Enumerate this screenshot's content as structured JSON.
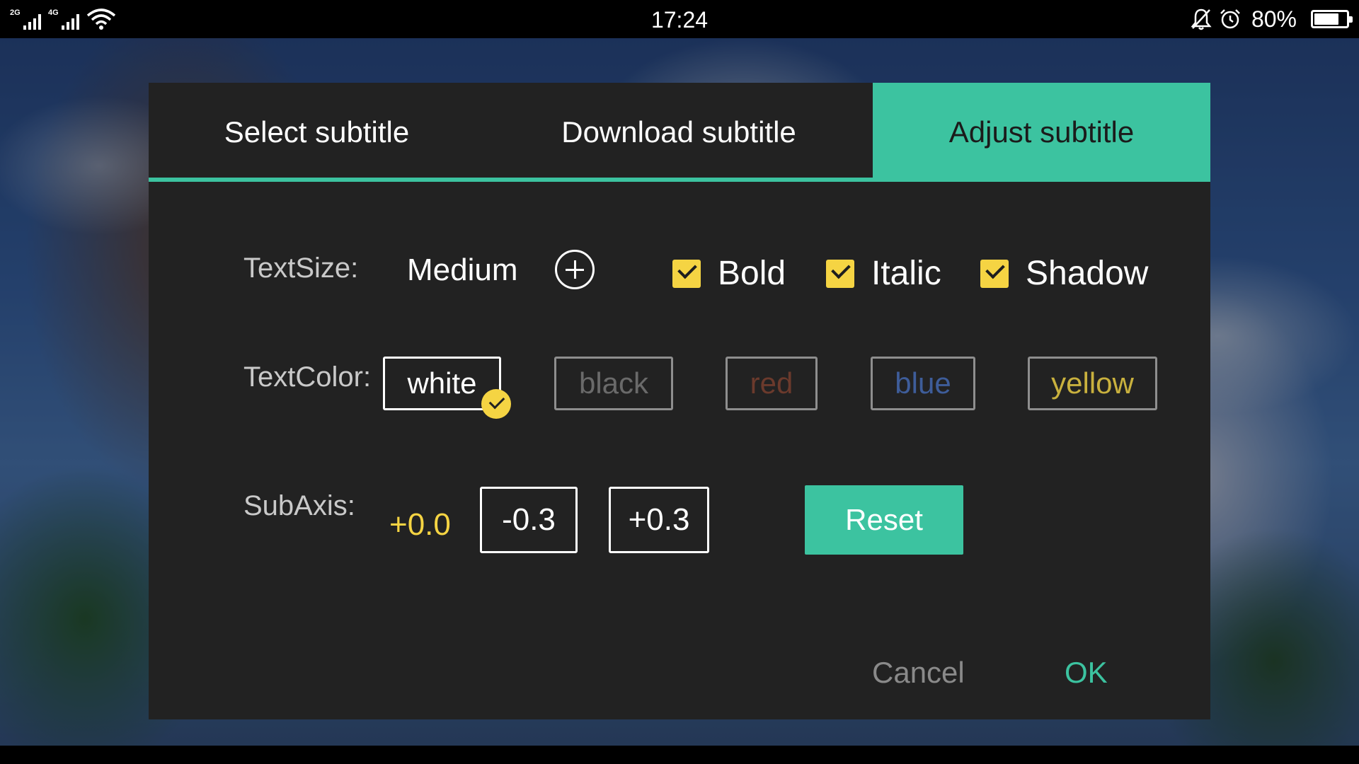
{
  "status_bar": {
    "network_1": "2G",
    "network_2": "4G",
    "time": "17:24",
    "battery_percent": "80%",
    "battery_level": 0.8,
    "icons": [
      "signal-icon",
      "signal-icon",
      "wifi-icon",
      "bell-muted-icon",
      "alarm-icon",
      "battery-icon"
    ]
  },
  "dialog": {
    "tabs": [
      {
        "label": "Select subtitle",
        "active": false
      },
      {
        "label": "Download subtitle",
        "active": false
      },
      {
        "label": "Adjust subtitle",
        "active": true
      }
    ],
    "text_size": {
      "label": "TextSize:",
      "value": "Medium"
    },
    "style_options": [
      {
        "label": "Bold",
        "checked": true
      },
      {
        "label": "Italic",
        "checked": true
      },
      {
        "label": "Shadow",
        "checked": true
      }
    ],
    "text_color": {
      "label": "TextColor:",
      "options": [
        {
          "label": "white",
          "color": "#ffffff",
          "selected": true
        },
        {
          "label": "black",
          "color": "#6a6a6a",
          "selected": false
        },
        {
          "label": "red",
          "color": "#6b3a2c",
          "selected": false
        },
        {
          "label": "blue",
          "color": "#3e5d9a",
          "selected": false
        },
        {
          "label": "yellow",
          "color": "#c9b13e",
          "selected": false
        }
      ]
    },
    "sub_axis": {
      "label": "SubAxis:",
      "value": "+0.0",
      "decrement_label": "-0.3",
      "increment_label": "+0.3",
      "reset_label": "Reset"
    },
    "cancel_label": "Cancel",
    "ok_label": "OK"
  },
  "colors": {
    "accent": "#3cc3a0",
    "checkbox": "#f5d443",
    "dialog_bg": "#222222",
    "ok_text": "#3cc3a0",
    "cancel_text": "#8a8a8a"
  }
}
